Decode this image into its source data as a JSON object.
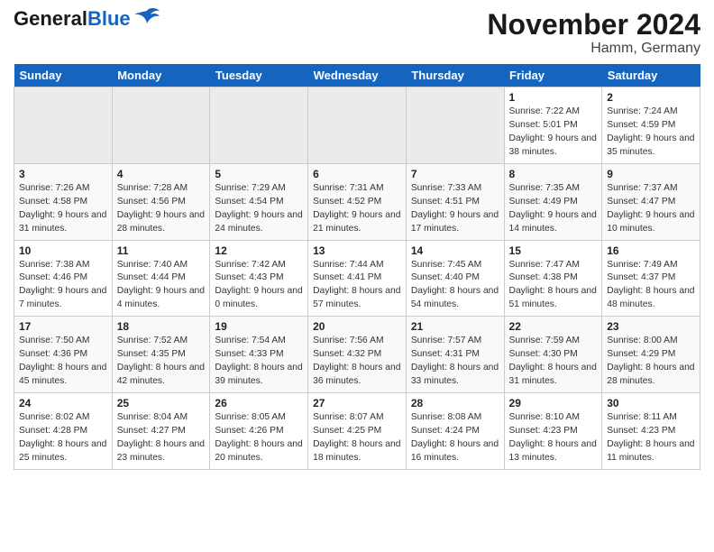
{
  "header": {
    "logo_general": "General",
    "logo_blue": "Blue",
    "title": "November 2024",
    "subtitle": "Hamm, Germany"
  },
  "weekdays": [
    "Sunday",
    "Monday",
    "Tuesday",
    "Wednesday",
    "Thursday",
    "Friday",
    "Saturday"
  ],
  "weeks": [
    [
      {
        "day": "",
        "info": ""
      },
      {
        "day": "",
        "info": ""
      },
      {
        "day": "",
        "info": ""
      },
      {
        "day": "",
        "info": ""
      },
      {
        "day": "",
        "info": ""
      },
      {
        "day": "1",
        "info": "Sunrise: 7:22 AM\nSunset: 5:01 PM\nDaylight: 9 hours and 38 minutes."
      },
      {
        "day": "2",
        "info": "Sunrise: 7:24 AM\nSunset: 4:59 PM\nDaylight: 9 hours and 35 minutes."
      }
    ],
    [
      {
        "day": "3",
        "info": "Sunrise: 7:26 AM\nSunset: 4:58 PM\nDaylight: 9 hours and 31 minutes."
      },
      {
        "day": "4",
        "info": "Sunrise: 7:28 AM\nSunset: 4:56 PM\nDaylight: 9 hours and 28 minutes."
      },
      {
        "day": "5",
        "info": "Sunrise: 7:29 AM\nSunset: 4:54 PM\nDaylight: 9 hours and 24 minutes."
      },
      {
        "day": "6",
        "info": "Sunrise: 7:31 AM\nSunset: 4:52 PM\nDaylight: 9 hours and 21 minutes."
      },
      {
        "day": "7",
        "info": "Sunrise: 7:33 AM\nSunset: 4:51 PM\nDaylight: 9 hours and 17 minutes."
      },
      {
        "day": "8",
        "info": "Sunrise: 7:35 AM\nSunset: 4:49 PM\nDaylight: 9 hours and 14 minutes."
      },
      {
        "day": "9",
        "info": "Sunrise: 7:37 AM\nSunset: 4:47 PM\nDaylight: 9 hours and 10 minutes."
      }
    ],
    [
      {
        "day": "10",
        "info": "Sunrise: 7:38 AM\nSunset: 4:46 PM\nDaylight: 9 hours and 7 minutes."
      },
      {
        "day": "11",
        "info": "Sunrise: 7:40 AM\nSunset: 4:44 PM\nDaylight: 9 hours and 4 minutes."
      },
      {
        "day": "12",
        "info": "Sunrise: 7:42 AM\nSunset: 4:43 PM\nDaylight: 9 hours and 0 minutes."
      },
      {
        "day": "13",
        "info": "Sunrise: 7:44 AM\nSunset: 4:41 PM\nDaylight: 8 hours and 57 minutes."
      },
      {
        "day": "14",
        "info": "Sunrise: 7:45 AM\nSunset: 4:40 PM\nDaylight: 8 hours and 54 minutes."
      },
      {
        "day": "15",
        "info": "Sunrise: 7:47 AM\nSunset: 4:38 PM\nDaylight: 8 hours and 51 minutes."
      },
      {
        "day": "16",
        "info": "Sunrise: 7:49 AM\nSunset: 4:37 PM\nDaylight: 8 hours and 48 minutes."
      }
    ],
    [
      {
        "day": "17",
        "info": "Sunrise: 7:50 AM\nSunset: 4:36 PM\nDaylight: 8 hours and 45 minutes."
      },
      {
        "day": "18",
        "info": "Sunrise: 7:52 AM\nSunset: 4:35 PM\nDaylight: 8 hours and 42 minutes."
      },
      {
        "day": "19",
        "info": "Sunrise: 7:54 AM\nSunset: 4:33 PM\nDaylight: 8 hours and 39 minutes."
      },
      {
        "day": "20",
        "info": "Sunrise: 7:56 AM\nSunset: 4:32 PM\nDaylight: 8 hours and 36 minutes."
      },
      {
        "day": "21",
        "info": "Sunrise: 7:57 AM\nSunset: 4:31 PM\nDaylight: 8 hours and 33 minutes."
      },
      {
        "day": "22",
        "info": "Sunrise: 7:59 AM\nSunset: 4:30 PM\nDaylight: 8 hours and 31 minutes."
      },
      {
        "day": "23",
        "info": "Sunrise: 8:00 AM\nSunset: 4:29 PM\nDaylight: 8 hours and 28 minutes."
      }
    ],
    [
      {
        "day": "24",
        "info": "Sunrise: 8:02 AM\nSunset: 4:28 PM\nDaylight: 8 hours and 25 minutes."
      },
      {
        "day": "25",
        "info": "Sunrise: 8:04 AM\nSunset: 4:27 PM\nDaylight: 8 hours and 23 minutes."
      },
      {
        "day": "26",
        "info": "Sunrise: 8:05 AM\nSunset: 4:26 PM\nDaylight: 8 hours and 20 minutes."
      },
      {
        "day": "27",
        "info": "Sunrise: 8:07 AM\nSunset: 4:25 PM\nDaylight: 8 hours and 18 minutes."
      },
      {
        "day": "28",
        "info": "Sunrise: 8:08 AM\nSunset: 4:24 PM\nDaylight: 8 hours and 16 minutes."
      },
      {
        "day": "29",
        "info": "Sunrise: 8:10 AM\nSunset: 4:23 PM\nDaylight: 8 hours and 13 minutes."
      },
      {
        "day": "30",
        "info": "Sunrise: 8:11 AM\nSunset: 4:23 PM\nDaylight: 8 hours and 11 minutes."
      }
    ]
  ]
}
